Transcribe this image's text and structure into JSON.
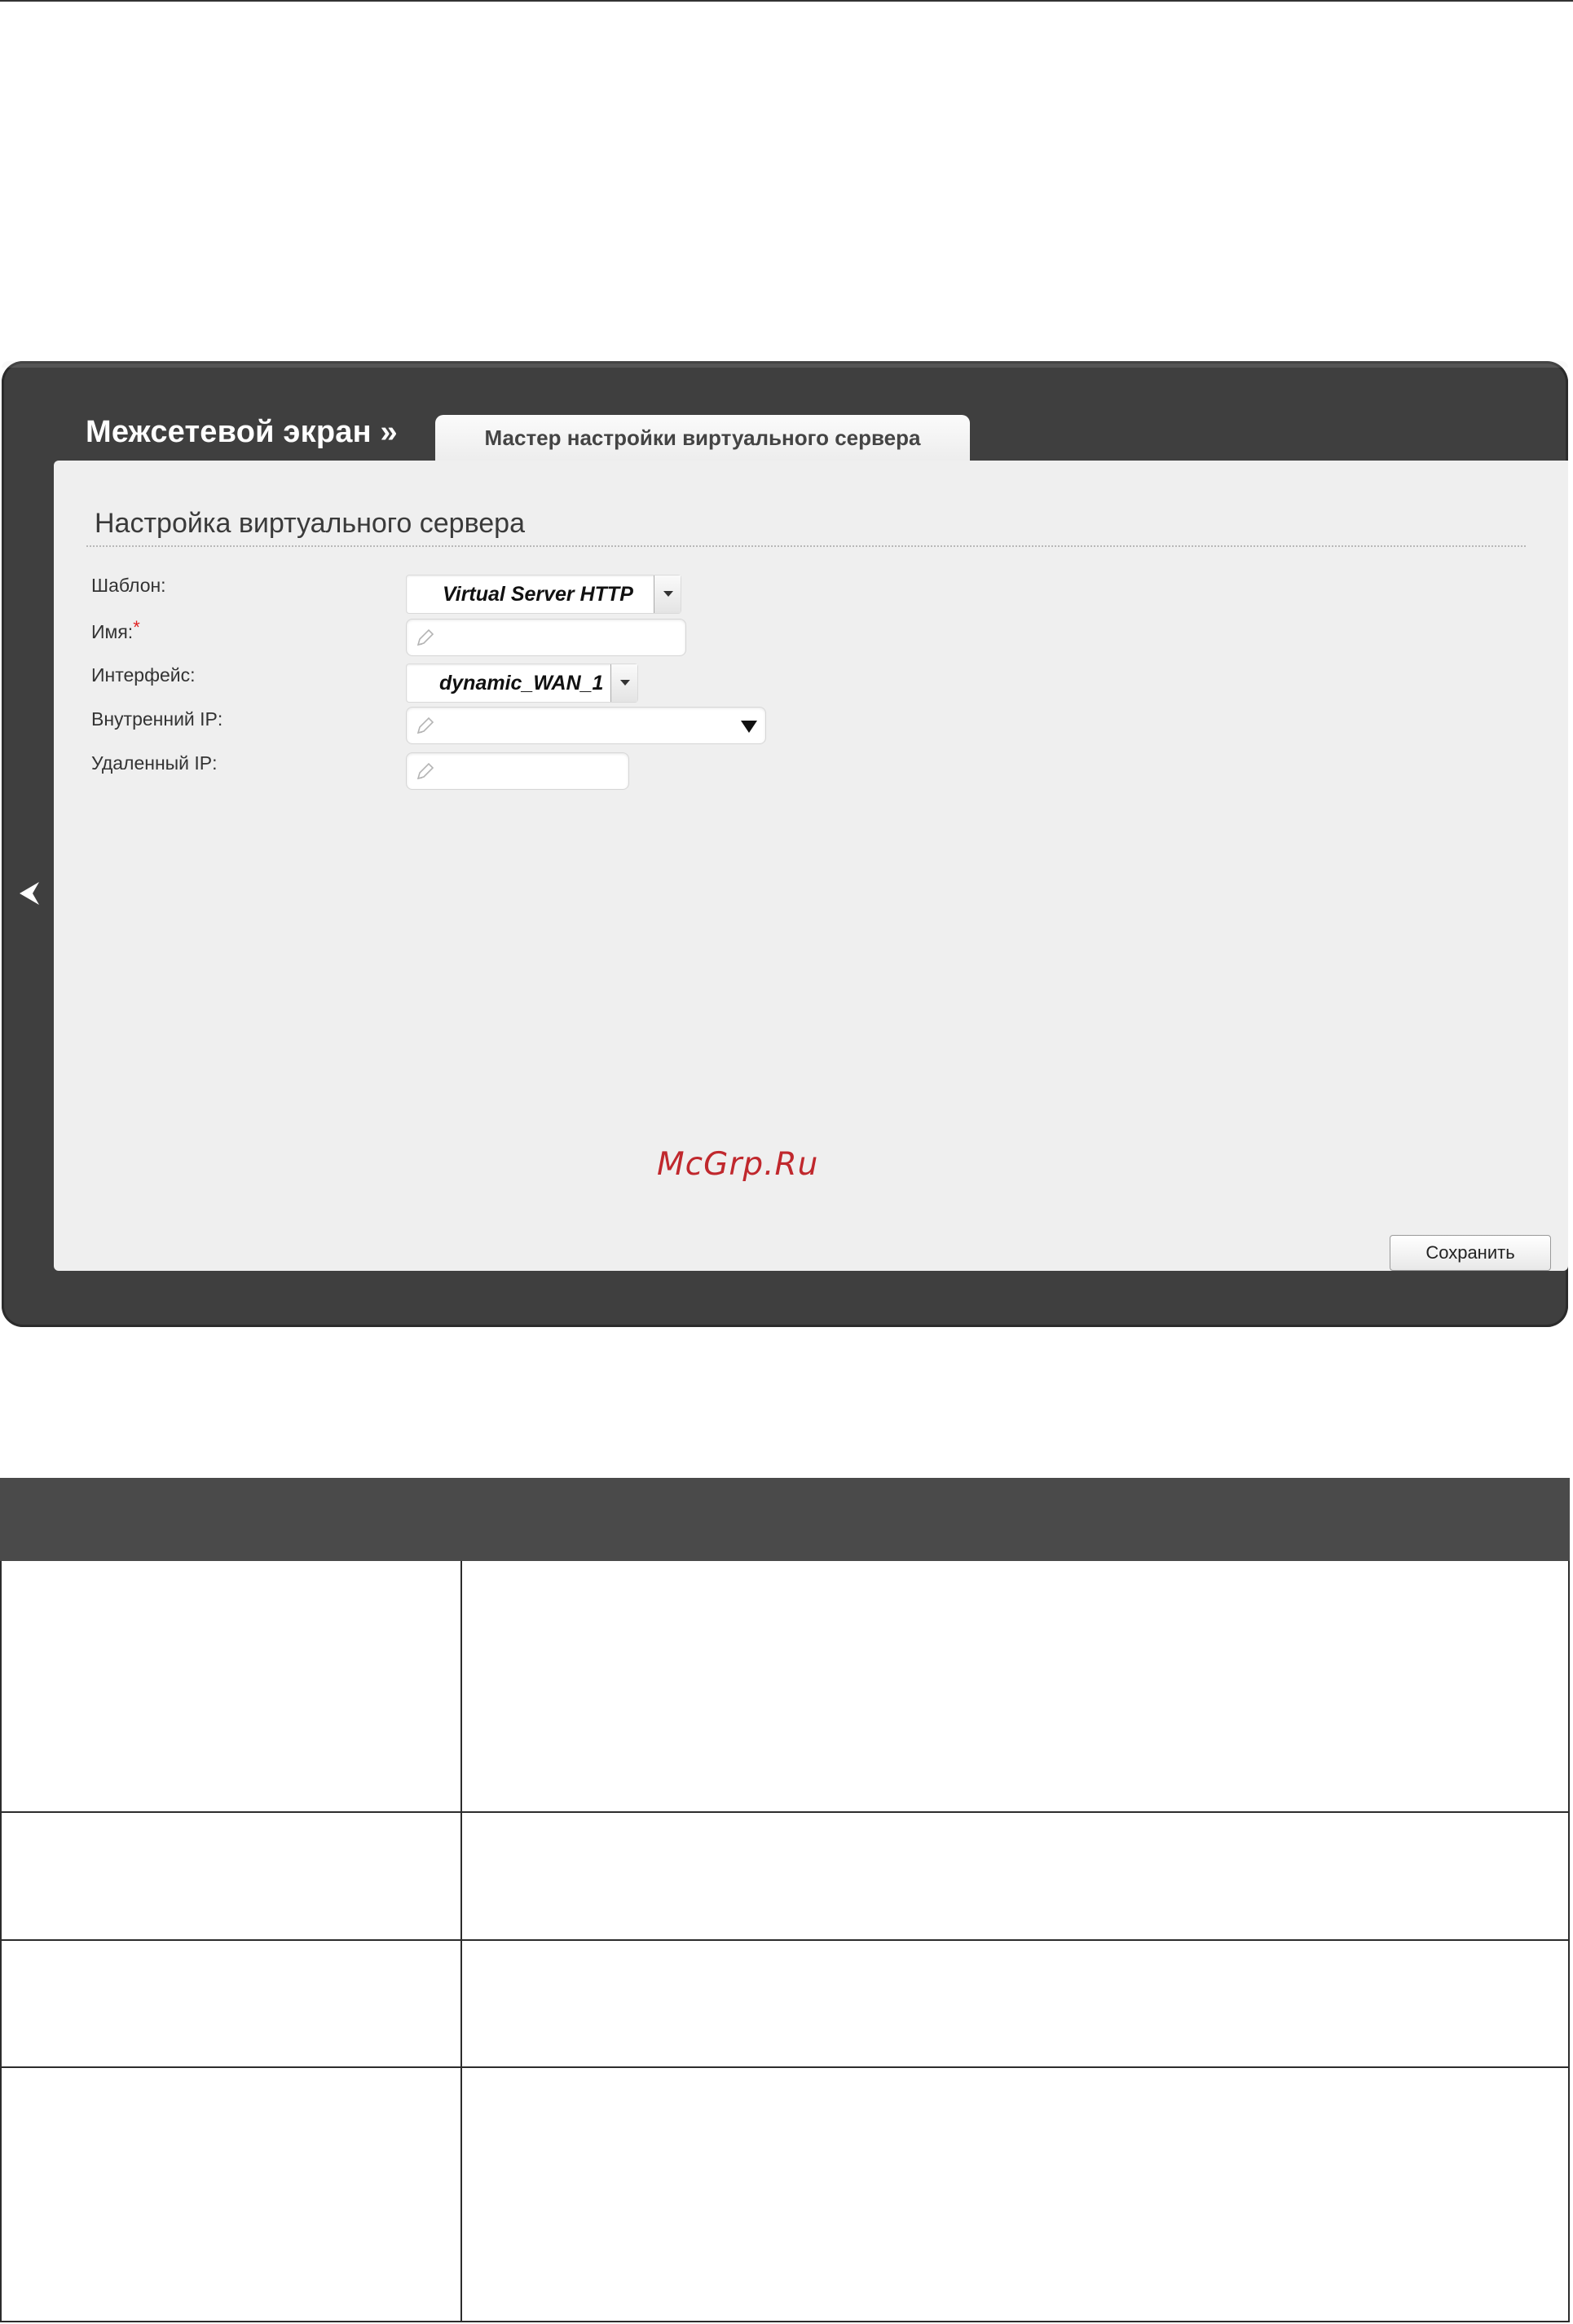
{
  "header": {
    "breadcrumb": "Межсетевой экран »",
    "active_tab": "Мастер настройки виртуального сервера"
  },
  "section": {
    "title": "Настройка виртуального сервера"
  },
  "form": {
    "template": {
      "label": "Шаблон:",
      "value": "Virtual Server HTTP"
    },
    "name": {
      "label": "Имя:",
      "required_mark": "*",
      "value": ""
    },
    "interface": {
      "label": "Интерфейс:",
      "value": "dynamic_WAN_1"
    },
    "internal_ip": {
      "label": "Внутренний IP:",
      "value": ""
    },
    "remote_ip": {
      "label": "Удаленный IP:",
      "value": ""
    }
  },
  "actions": {
    "save_label": "Сохранить"
  },
  "watermark": "McGrp.Ru",
  "icons": {
    "back": "chevron-left-icon",
    "edit": "pencil-icon",
    "dropdown": "triangle-down-icon"
  },
  "colors": {
    "frame": "#3f3f3f",
    "panel": "#efefef",
    "required": "#e02020",
    "watermark": "#c0282d"
  }
}
